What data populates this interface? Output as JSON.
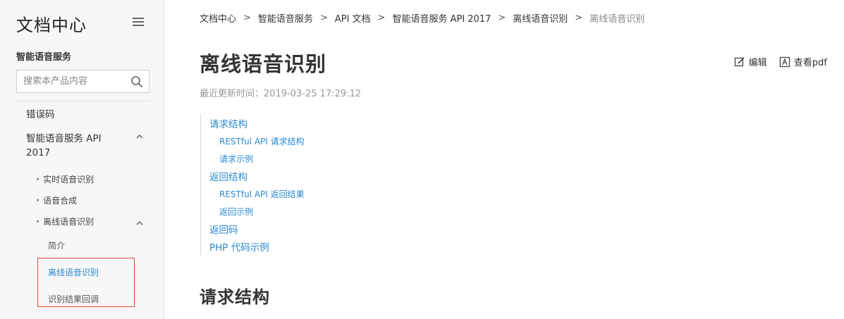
{
  "sidebar": {
    "title": "文档中心",
    "product": "智能语音服务",
    "search": {
      "placeholder": "搜索本产品内容",
      "value": ""
    },
    "items": {
      "error_codes": "错误码",
      "api2017_line1": "智能语音服务 API",
      "api2017_line2": "2017",
      "realtime": "实时语音识别",
      "tts": "语音合成",
      "offline": "离线语音识别",
      "intro": "简介",
      "offline_active": "离线语音识别",
      "callback": "识别结果回调"
    },
    "bullet": "•"
  },
  "breadcrumb": {
    "items": [
      "文档中心",
      "智能语音服务",
      "API 文档",
      "智能语音服务 API 2017",
      "离线语音识别",
      "离线语音识别"
    ],
    "separator": ">"
  },
  "doc": {
    "title": "离线语音识别",
    "updated": "最近更新时间：2019-03-25 17:29:12"
  },
  "actions": {
    "edit": "编辑",
    "pdf": "查看pdf"
  },
  "toc": {
    "request_structure": "请求结构",
    "restful_request": "RESTful API 请求结构",
    "request_example": "请求示例",
    "response_structure": "返回结构",
    "restful_response": "RESTful API 返回结果",
    "response_example": "返回示例",
    "return_codes": "返回码",
    "php_example": "PHP 代码示例"
  },
  "section": {
    "heading": "请求结构"
  },
  "colors": {
    "link": "#2a8ad2",
    "active_border": "#e0453d",
    "sidebar_bg": "#f7f7f7"
  }
}
